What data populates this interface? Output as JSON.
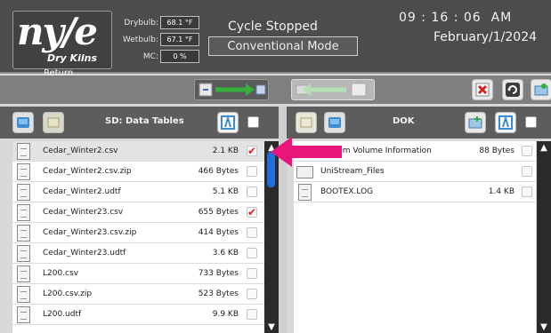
{
  "header": {
    "logo": "ny/e",
    "logo_sub": "Dry Kilns",
    "return_label": "Return",
    "readings": [
      {
        "label": "Drybulb:",
        "value": "68.1 °F"
      },
      {
        "label": "Wetbulb:",
        "value": "67.1 °F"
      },
      {
        "label": "MC:",
        "value": "0 %"
      }
    ],
    "cycle_status": "Cycle Stopped",
    "mode": "Conventional Mode",
    "time": "09 : 16 : 06  AM",
    "date": "February/1/2024"
  },
  "left_panel": {
    "title": "SD: Data Tables",
    "files": [
      {
        "name": "Cedar_Winter2.csv",
        "size": "2.1 KB",
        "checked": true
      },
      {
        "name": "Cedar_Winter2.csv.zip",
        "size": "466 Bytes",
        "checked": false
      },
      {
        "name": "Cedar_Winter2.udtf",
        "size": "5.1 KB",
        "checked": false
      },
      {
        "name": "Cedar_Winter23.csv",
        "size": "655 Bytes",
        "checked": true
      },
      {
        "name": "Cedar_Winter23.csv.zip",
        "size": "414 Bytes",
        "checked": false
      },
      {
        "name": "Cedar_Winter23.udtf",
        "size": "3.6 KB",
        "checked": false
      },
      {
        "name": "L200.csv",
        "size": "733 Bytes",
        "checked": false
      },
      {
        "name": "L200.csv.zip",
        "size": "523 Bytes",
        "checked": false
      },
      {
        "name": "L200.udtf",
        "size": "9.9 KB",
        "checked": false
      }
    ]
  },
  "right_panel": {
    "title": "DOK",
    "files": [
      {
        "name": "System Volume Information",
        "size": "88 Bytes",
        "folder": true
      },
      {
        "name": "UniStream_Files",
        "size": "",
        "folder": true
      },
      {
        "name": "BOOTEX.LOG",
        "size": "1.4 KB",
        "folder": false
      }
    ]
  },
  "colors": {
    "header_bg": "#4c4c4c",
    "check_red": "#e02020",
    "annotation_arrow": "#e8157a",
    "scroll_thumb": "#1e6fd9"
  },
  "icons": [
    "sd-card-icon",
    "usb-icon",
    "select-all-icon",
    "delete-icon",
    "refresh-icon",
    "copy-right-icon",
    "copy-left-icon",
    "new-folder-icon"
  ]
}
